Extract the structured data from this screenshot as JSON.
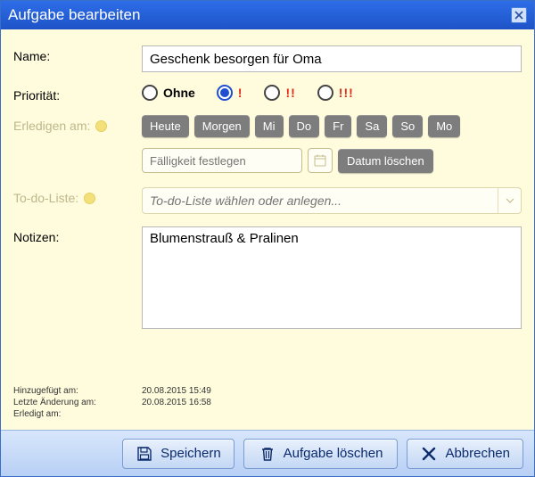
{
  "window": {
    "title": "Aufgabe bearbeiten"
  },
  "labels": {
    "name": "Name:",
    "priority": "Priorität:",
    "dueDate": "Erledigen am:",
    "todoList": "To-do-Liste:",
    "notes": "Notizen:"
  },
  "fields": {
    "name": "Geschenk besorgen für Oma",
    "dueDatePlaceholder": "Fälligkeit festlegen",
    "todoPlaceholder": "To-do-Liste wählen oder anlegen...",
    "notes": "Blumenstrauß & Pralinen"
  },
  "priority": {
    "selectedIndex": 1,
    "options": [
      {
        "label": "Ohne",
        "red": false
      },
      {
        "label": "!",
        "red": true
      },
      {
        "label": "!!",
        "red": true
      },
      {
        "label": "!!!",
        "red": true
      }
    ]
  },
  "dayButtons": [
    "Heute",
    "Morgen",
    "Mi",
    "Do",
    "Fr",
    "Sa",
    "So",
    "Mo"
  ],
  "clearDateLabel": "Datum löschen",
  "meta": {
    "addedLabel": "Hinzugefügt am:",
    "addedValue": "20.08.2015 15:49",
    "changedLabel": "Letzte Änderung am:",
    "changedValue": "20.08.2015 16:58",
    "doneLabel": "Erledigt am:",
    "doneValue": ""
  },
  "footer": {
    "save": "Speichern",
    "delete": "Aufgabe löschen",
    "cancel": "Abbrechen"
  }
}
